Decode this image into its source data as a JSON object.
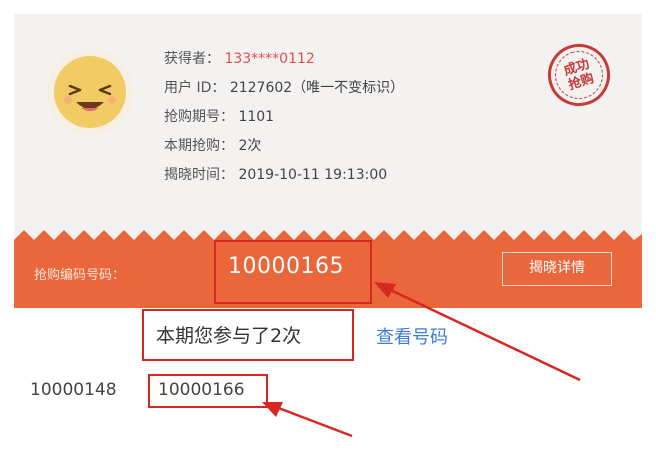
{
  "header": {
    "winner_label": "获得者：",
    "winner_value": "133****0112",
    "user_id_label": "用户 ID：",
    "user_id_value": "2127602（唯一不变标识）",
    "period_label": "抢购期号：",
    "period_value": "1101",
    "times_label": "本期抢购：",
    "times_value": "2次",
    "reveal_time_label": "揭晓时间：",
    "reveal_time_value": "2019-10-11 19:13:00"
  },
  "stamp": {
    "line1": "成功",
    "line2": "抢购"
  },
  "band": {
    "label": "抢购编码号码：",
    "code": "10000165",
    "detail_button": "揭晓详情"
  },
  "participation": {
    "text": "本期您参与了2次",
    "view_link": "查看号码"
  },
  "codes": [
    "10000148",
    "10000166"
  ],
  "colors": {
    "band": "#e9673b",
    "highlight": "#d6281f",
    "link": "#3f7ed4",
    "winner": "#e0504a",
    "avatar": "#f3cb64"
  },
  "icons": {
    "avatar": "laughing-face-icon",
    "stamp": "success-stamp-icon",
    "arrows": "red-arrow-icon"
  }
}
